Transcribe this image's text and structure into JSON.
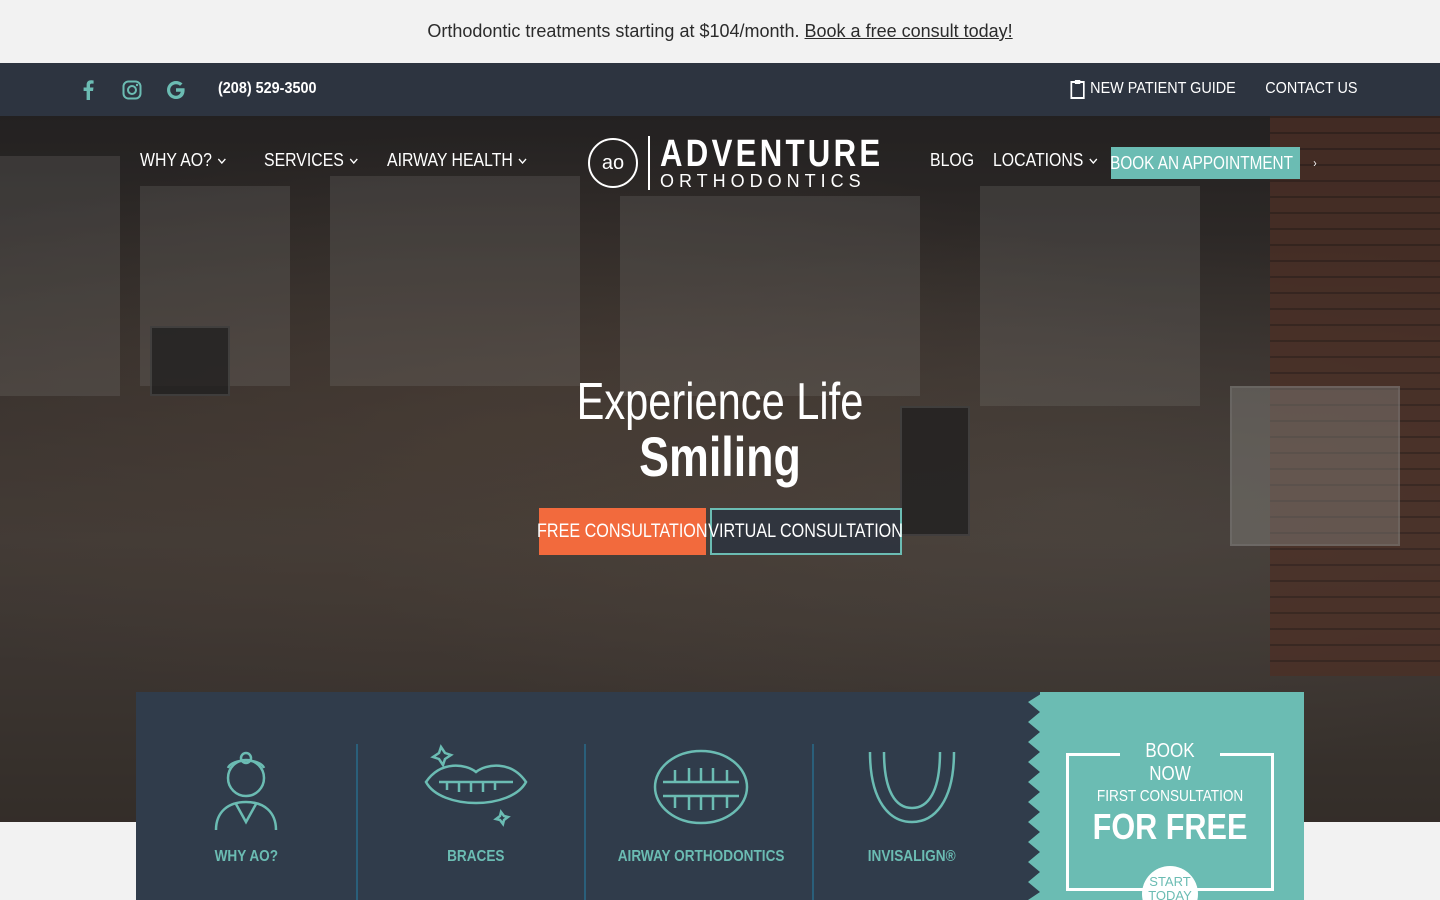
{
  "promo": {
    "text": "Orthodontic treatments starting at $104/month.",
    "link": "Book a free consult today!"
  },
  "utility": {
    "phone": "(208) 529-3500",
    "guide": "NEW PATIENT GUIDE",
    "contact": "CONTACT US"
  },
  "nav": {
    "why": "WHY AO?",
    "services": "SERVICES",
    "airway": "AIRWAY HEALTH",
    "blog": "BLOG",
    "locations": "LOCATIONS",
    "book": "BOOK AN APPOINTMENT"
  },
  "logo": {
    "mark": "ao",
    "line1": "ADVENTURE",
    "line2": "ORTHODONTICS"
  },
  "hero": {
    "line1": "Experience Life",
    "line2": "Smiling",
    "cta_free": "FREE CONSULTATION",
    "cta_virtual": "VIRTUAL CONSULTATION"
  },
  "services": [
    {
      "label": "WHY AO?",
      "icon": "orthodontist-icon"
    },
    {
      "label": "BRACES",
      "icon": "smile-braces-icon"
    },
    {
      "label": "AIRWAY ORTHODONTICS",
      "icon": "teeth-icon"
    },
    {
      "label": "INVISALIGN®",
      "icon": "aligner-icon"
    }
  ],
  "promo_card": {
    "title": "BOOK NOW",
    "sub": "FIRST CONSULTATION",
    "big": "FOR FREE",
    "badge_l1": "START",
    "badge_l2": "TODAY"
  },
  "colors": {
    "accent": "#6bbcb3",
    "cta": "#f26a3d",
    "dark": "#2d3440",
    "panel": "#303c4b"
  }
}
